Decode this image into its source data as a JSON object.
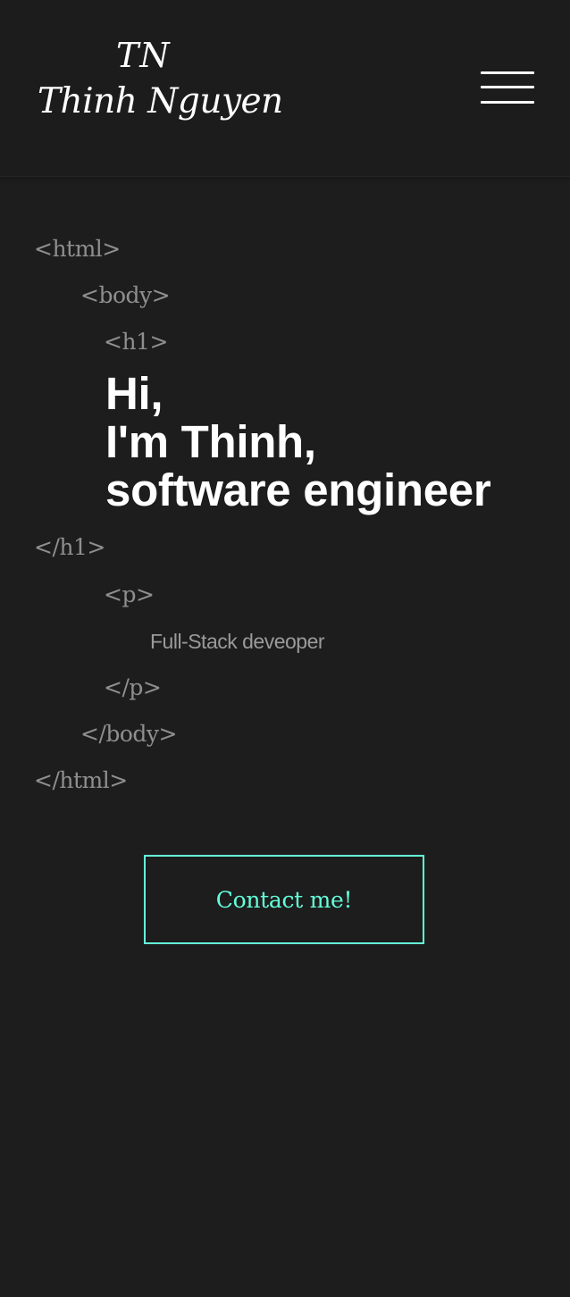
{
  "header": {
    "logo_initials": "TN",
    "logo_name": "Thinh Nguyen",
    "menu_icon": "hamburger-menu-icon"
  },
  "code": {
    "html_open": "<html>",
    "body_open": "<body>",
    "h1_open": "<h1>",
    "headline": [
      "Hi,",
      "I'm Thinh,",
      "software engineer"
    ],
    "h1_close": "</h1>",
    "p_open": "<p>",
    "subtitle": "Full-Stack deveoper",
    "p_close": "</p>",
    "body_close": "</body>",
    "html_close": "</html>"
  },
  "contact": {
    "label": "Contact me!"
  },
  "colors": {
    "background": "#1d1d1d",
    "accent": "#64ffda",
    "tag_text": "#8f8f8f",
    "headline": "#ffffff"
  }
}
